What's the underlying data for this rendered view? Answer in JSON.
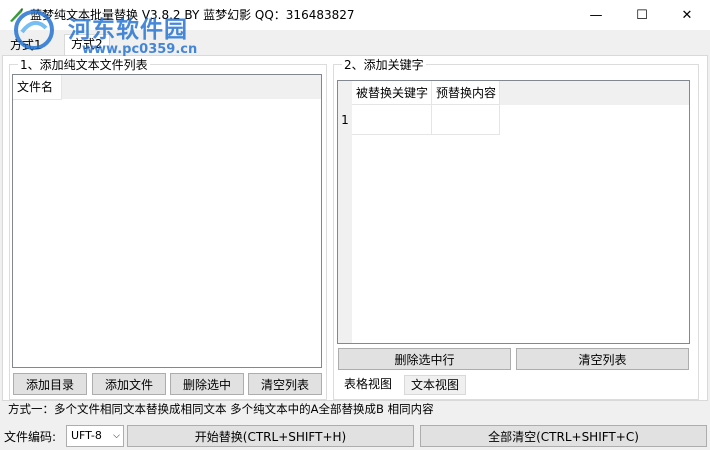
{
  "window": {
    "title": "蓝梦纯文本批量替换 V3.8.2 BY 蓝梦幻影 QQ：316483827",
    "controls": {
      "minimize": "—",
      "maximize": "☐",
      "close": "✕"
    }
  },
  "watermark": {
    "text": "河东软件园",
    "url": "www.pc0359.cn"
  },
  "tabs": [
    {
      "label": "方式1"
    },
    {
      "label": "方式2"
    }
  ],
  "left_group": {
    "title": "1、添加纯文本文件列表",
    "list_header": "文件名",
    "buttons": {
      "add_dir": "添加目录",
      "add_file": "添加文件",
      "delete_selected": "删除选中",
      "clear_list": "清空列表"
    }
  },
  "right_group": {
    "title": "2、添加关键字",
    "grid": {
      "columns": [
        "被替换关键字",
        "预替换内容"
      ],
      "rows": [
        {
          "num": "1",
          "cells": [
            "",
            ""
          ]
        }
      ]
    },
    "buttons": {
      "delete_row": "删除选中行",
      "clear_list": "清空列表"
    },
    "view_tabs": {
      "table": "表格视图",
      "text": "文本视图"
    }
  },
  "mode_info": "方式一：多个文件相同文本替换成相同文本   多个纯文本中的A全部替换成B 相同内容",
  "bottom": {
    "encoding_label": "文件编码:",
    "encoding_value": "UFT-8",
    "start_button": "开始替换(CTRL+SHIFT+H)",
    "clear_button": "全部清空(CTRL+SHIFT+C)"
  },
  "colors": {
    "watermark": "#1f6fd1",
    "panel_bg": "#f0f0f0",
    "button_bg": "#e1e1e1"
  }
}
